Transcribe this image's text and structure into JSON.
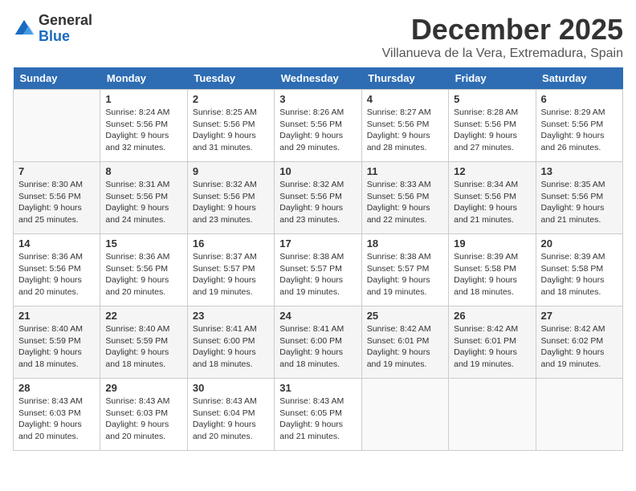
{
  "logo": {
    "text_general": "General",
    "text_blue": "Blue"
  },
  "title": {
    "month_year": "December 2025",
    "location": "Villanueva de la Vera, Extremadura, Spain"
  },
  "weekdays": [
    "Sunday",
    "Monday",
    "Tuesday",
    "Wednesday",
    "Thursday",
    "Friday",
    "Saturday"
  ],
  "weeks": [
    [
      {
        "day": "",
        "sunrise": "",
        "sunset": "",
        "daylight": ""
      },
      {
        "day": "1",
        "sunrise": "Sunrise: 8:24 AM",
        "sunset": "Sunset: 5:56 PM",
        "daylight": "Daylight: 9 hours and 32 minutes."
      },
      {
        "day": "2",
        "sunrise": "Sunrise: 8:25 AM",
        "sunset": "Sunset: 5:56 PM",
        "daylight": "Daylight: 9 hours and 31 minutes."
      },
      {
        "day": "3",
        "sunrise": "Sunrise: 8:26 AM",
        "sunset": "Sunset: 5:56 PM",
        "daylight": "Daylight: 9 hours and 29 minutes."
      },
      {
        "day": "4",
        "sunrise": "Sunrise: 8:27 AM",
        "sunset": "Sunset: 5:56 PM",
        "daylight": "Daylight: 9 hours and 28 minutes."
      },
      {
        "day": "5",
        "sunrise": "Sunrise: 8:28 AM",
        "sunset": "Sunset: 5:56 PM",
        "daylight": "Daylight: 9 hours and 27 minutes."
      },
      {
        "day": "6",
        "sunrise": "Sunrise: 8:29 AM",
        "sunset": "Sunset: 5:56 PM",
        "daylight": "Daylight: 9 hours and 26 minutes."
      }
    ],
    [
      {
        "day": "7",
        "sunrise": "Sunrise: 8:30 AM",
        "sunset": "Sunset: 5:56 PM",
        "daylight": "Daylight: 9 hours and 25 minutes."
      },
      {
        "day": "8",
        "sunrise": "Sunrise: 8:31 AM",
        "sunset": "Sunset: 5:56 PM",
        "daylight": "Daylight: 9 hours and 24 minutes."
      },
      {
        "day": "9",
        "sunrise": "Sunrise: 8:32 AM",
        "sunset": "Sunset: 5:56 PM",
        "daylight": "Daylight: 9 hours and 23 minutes."
      },
      {
        "day": "10",
        "sunrise": "Sunrise: 8:32 AM",
        "sunset": "Sunset: 5:56 PM",
        "daylight": "Daylight: 9 hours and 23 minutes."
      },
      {
        "day": "11",
        "sunrise": "Sunrise: 8:33 AM",
        "sunset": "Sunset: 5:56 PM",
        "daylight": "Daylight: 9 hours and 22 minutes."
      },
      {
        "day": "12",
        "sunrise": "Sunrise: 8:34 AM",
        "sunset": "Sunset: 5:56 PM",
        "daylight": "Daylight: 9 hours and 21 minutes."
      },
      {
        "day": "13",
        "sunrise": "Sunrise: 8:35 AM",
        "sunset": "Sunset: 5:56 PM",
        "daylight": "Daylight: 9 hours and 21 minutes."
      }
    ],
    [
      {
        "day": "14",
        "sunrise": "Sunrise: 8:36 AM",
        "sunset": "Sunset: 5:56 PM",
        "daylight": "Daylight: 9 hours and 20 minutes."
      },
      {
        "day": "15",
        "sunrise": "Sunrise: 8:36 AM",
        "sunset": "Sunset: 5:56 PM",
        "daylight": "Daylight: 9 hours and 20 minutes."
      },
      {
        "day": "16",
        "sunrise": "Sunrise: 8:37 AM",
        "sunset": "Sunset: 5:57 PM",
        "daylight": "Daylight: 9 hours and 19 minutes."
      },
      {
        "day": "17",
        "sunrise": "Sunrise: 8:38 AM",
        "sunset": "Sunset: 5:57 PM",
        "daylight": "Daylight: 9 hours and 19 minutes."
      },
      {
        "day": "18",
        "sunrise": "Sunrise: 8:38 AM",
        "sunset": "Sunset: 5:57 PM",
        "daylight": "Daylight: 9 hours and 19 minutes."
      },
      {
        "day": "19",
        "sunrise": "Sunrise: 8:39 AM",
        "sunset": "Sunset: 5:58 PM",
        "daylight": "Daylight: 9 hours and 18 minutes."
      },
      {
        "day": "20",
        "sunrise": "Sunrise: 8:39 AM",
        "sunset": "Sunset: 5:58 PM",
        "daylight": "Daylight: 9 hours and 18 minutes."
      }
    ],
    [
      {
        "day": "21",
        "sunrise": "Sunrise: 8:40 AM",
        "sunset": "Sunset: 5:59 PM",
        "daylight": "Daylight: 9 hours and 18 minutes."
      },
      {
        "day": "22",
        "sunrise": "Sunrise: 8:40 AM",
        "sunset": "Sunset: 5:59 PM",
        "daylight": "Daylight: 9 hours and 18 minutes."
      },
      {
        "day": "23",
        "sunrise": "Sunrise: 8:41 AM",
        "sunset": "Sunset: 6:00 PM",
        "daylight": "Daylight: 9 hours and 18 minutes."
      },
      {
        "day": "24",
        "sunrise": "Sunrise: 8:41 AM",
        "sunset": "Sunset: 6:00 PM",
        "daylight": "Daylight: 9 hours and 18 minutes."
      },
      {
        "day": "25",
        "sunrise": "Sunrise: 8:42 AM",
        "sunset": "Sunset: 6:01 PM",
        "daylight": "Daylight: 9 hours and 19 minutes."
      },
      {
        "day": "26",
        "sunrise": "Sunrise: 8:42 AM",
        "sunset": "Sunset: 6:01 PM",
        "daylight": "Daylight: 9 hours and 19 minutes."
      },
      {
        "day": "27",
        "sunrise": "Sunrise: 8:42 AM",
        "sunset": "Sunset: 6:02 PM",
        "daylight": "Daylight: 9 hours and 19 minutes."
      }
    ],
    [
      {
        "day": "28",
        "sunrise": "Sunrise: 8:43 AM",
        "sunset": "Sunset: 6:03 PM",
        "daylight": "Daylight: 9 hours and 20 minutes."
      },
      {
        "day": "29",
        "sunrise": "Sunrise: 8:43 AM",
        "sunset": "Sunset: 6:03 PM",
        "daylight": "Daylight: 9 hours and 20 minutes."
      },
      {
        "day": "30",
        "sunrise": "Sunrise: 8:43 AM",
        "sunset": "Sunset: 6:04 PM",
        "daylight": "Daylight: 9 hours and 20 minutes."
      },
      {
        "day": "31",
        "sunrise": "Sunrise: 8:43 AM",
        "sunset": "Sunset: 6:05 PM",
        "daylight": "Daylight: 9 hours and 21 minutes."
      },
      {
        "day": "",
        "sunrise": "",
        "sunset": "",
        "daylight": ""
      },
      {
        "day": "",
        "sunrise": "",
        "sunset": "",
        "daylight": ""
      },
      {
        "day": "",
        "sunrise": "",
        "sunset": "",
        "daylight": ""
      }
    ]
  ]
}
